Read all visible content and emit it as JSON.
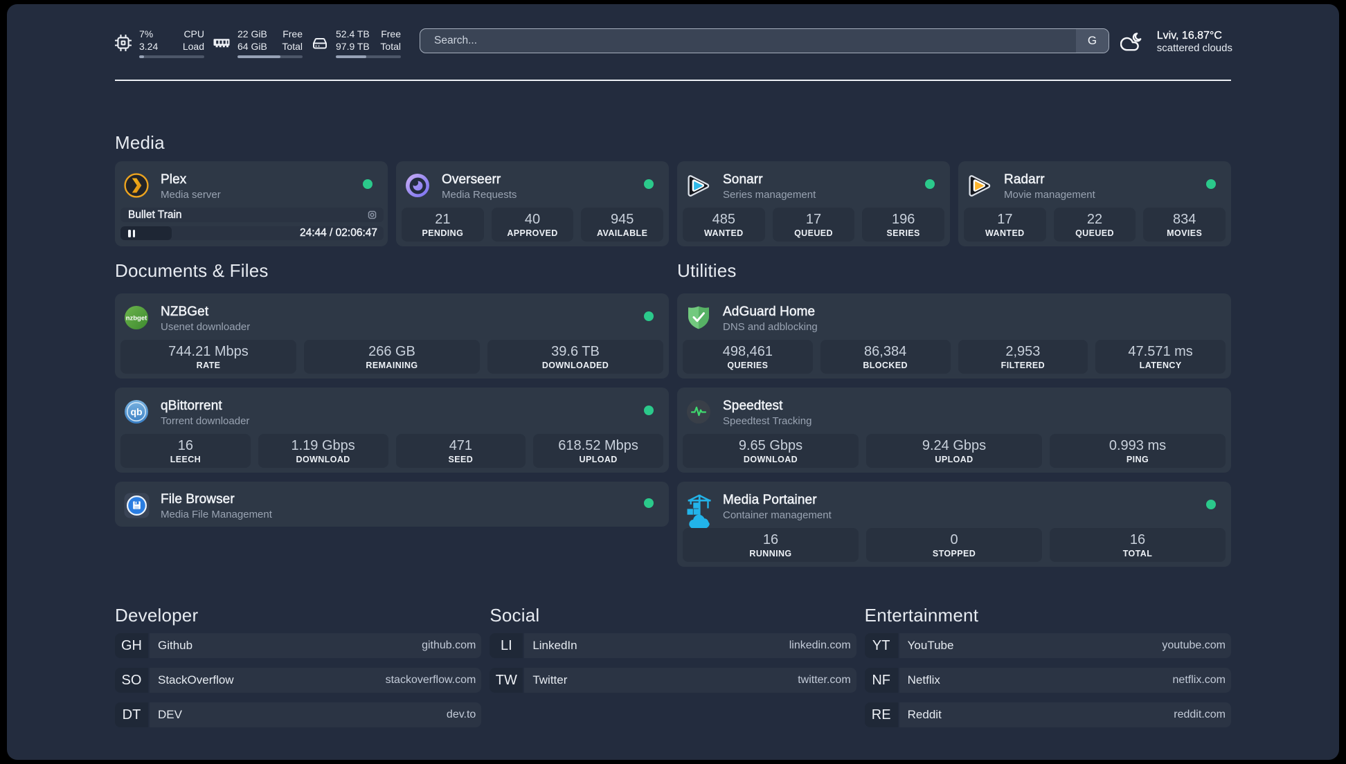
{
  "topbar": {
    "resources": [
      {
        "icon": "cpu-icon",
        "rows": [
          {
            "value": "7%",
            "label": "CPU"
          },
          {
            "value": "3.24",
            "label": "Load"
          }
        ],
        "progress_pct": 7
      },
      {
        "icon": "memory-icon",
        "rows": [
          {
            "value": "22 GiB",
            "label": "Free"
          },
          {
            "value": "64 GiB",
            "label": "Total"
          }
        ],
        "progress_pct": 65.6
      },
      {
        "icon": "disk-icon",
        "rows": [
          {
            "value": "52.4 TB",
            "label": "Free"
          },
          {
            "value": "97.9 TB",
            "label": "Total"
          }
        ],
        "progress_pct": 46.5
      }
    ],
    "search": {
      "placeholder": "Search...",
      "button_label": "G"
    },
    "weather": {
      "icon": "scattered-clouds-night-icon",
      "headline": "Lviv, 16.87°C",
      "condition": "scattered clouds"
    }
  },
  "groups": [
    {
      "title": "Media",
      "services": [
        {
          "title": "Plex",
          "subtitle": "Media server",
          "icon": "plex-icon",
          "status": "online",
          "now_playing": {
            "name": "Bullet Train",
            "progress_pct": 19.6,
            "time_text": "24:44 / 02:06:47"
          }
        },
        {
          "title": "Overseerr",
          "subtitle": "Media Requests",
          "icon": "overseerr-icon",
          "status": "online",
          "stats": [
            {
              "value": "21",
              "label": "PENDING"
            },
            {
              "value": "40",
              "label": "APPROVED"
            },
            {
              "value": "945",
              "label": "AVAILABLE"
            }
          ]
        },
        {
          "title": "Sonarr",
          "subtitle": "Series management",
          "icon": "sonarr-icon",
          "status": "online",
          "stats": [
            {
              "value": "485",
              "label": "WANTED"
            },
            {
              "value": "17",
              "label": "QUEUED"
            },
            {
              "value": "196",
              "label": "SERIES"
            }
          ]
        },
        {
          "title": "Radarr",
          "subtitle": "Movie management",
          "icon": "radarr-icon",
          "status": "online",
          "stats": [
            {
              "value": "17",
              "label": "WANTED"
            },
            {
              "value": "22",
              "label": "QUEUED"
            },
            {
              "value": "834",
              "label": "MOVIES"
            }
          ]
        }
      ]
    },
    {
      "title": "Documents & Files",
      "services": [
        {
          "title": "NZBGet",
          "subtitle": "Usenet downloader",
          "icon": "nzbget-icon",
          "status": "online",
          "stats": [
            {
              "value": "744.21 Mbps",
              "label": "RATE"
            },
            {
              "value": "266 GB",
              "label": "REMAINING"
            },
            {
              "value": "39.6 TB",
              "label": "DOWNLOADED"
            }
          ]
        },
        {
          "title": "qBittorrent",
          "subtitle": "Torrent downloader",
          "icon": "qbittorrent-icon",
          "status": "online",
          "stats": [
            {
              "value": "16",
              "label": "LEECH"
            },
            {
              "value": "1.19 Gbps",
              "label": "DOWNLOAD"
            },
            {
              "value": "471",
              "label": "SEED"
            },
            {
              "value": "618.52 Mbps",
              "label": "UPLOAD"
            }
          ]
        },
        {
          "title": "File Browser",
          "subtitle": "Media File Management",
          "icon": "filebrowser-icon",
          "status": "online",
          "stats": []
        }
      ]
    },
    {
      "title": "Utilities",
      "services": [
        {
          "title": "AdGuard Home",
          "subtitle": "DNS and adblocking",
          "icon": "adguard-icon",
          "status": "none",
          "stats": [
            {
              "value": "498,461",
              "label": "QUERIES"
            },
            {
              "value": "86,384",
              "label": "BLOCKED"
            },
            {
              "value": "2,953",
              "label": "FILTERED"
            },
            {
              "value": "47.571 ms",
              "label": "LATENCY"
            }
          ]
        },
        {
          "title": "Speedtest",
          "subtitle": "Speedtest Tracking",
          "icon": "speedtest-icon",
          "status": "none",
          "stats": [
            {
              "value": "9.65 Gbps",
              "label": "DOWNLOAD"
            },
            {
              "value": "9.24 Gbps",
              "label": "UPLOAD"
            },
            {
              "value": "0.993 ms",
              "label": "PING"
            }
          ]
        },
        {
          "title": "Media Portainer",
          "subtitle": "Container management",
          "icon": "portainer-icon",
          "status": "online",
          "stats": [
            {
              "value": "16",
              "label": "RUNNING"
            },
            {
              "value": "0",
              "label": "STOPPED"
            },
            {
              "value": "16",
              "label": "TOTAL"
            }
          ]
        }
      ]
    }
  ],
  "bookmarks": [
    {
      "title": "Developer",
      "items": [
        {
          "abbr": "GH",
          "name": "Github",
          "url": "github.com"
        },
        {
          "abbr": "SO",
          "name": "StackOverflow",
          "url": "stackoverflow.com"
        },
        {
          "abbr": "DT",
          "name": "DEV",
          "url": "dev.to"
        }
      ]
    },
    {
      "title": "Social",
      "items": [
        {
          "abbr": "LI",
          "name": "LinkedIn",
          "url": "linkedin.com"
        },
        {
          "abbr": "TW",
          "name": "Twitter",
          "url": "twitter.com"
        }
      ]
    },
    {
      "title": "Entertainment",
      "items": [
        {
          "abbr": "YT",
          "name": "YouTube",
          "url": "youtube.com"
        },
        {
          "abbr": "NF",
          "name": "Netflix",
          "url": "netflix.com"
        },
        {
          "abbr": "RE",
          "name": "Reddit",
          "url": "reddit.com"
        }
      ]
    }
  ]
}
